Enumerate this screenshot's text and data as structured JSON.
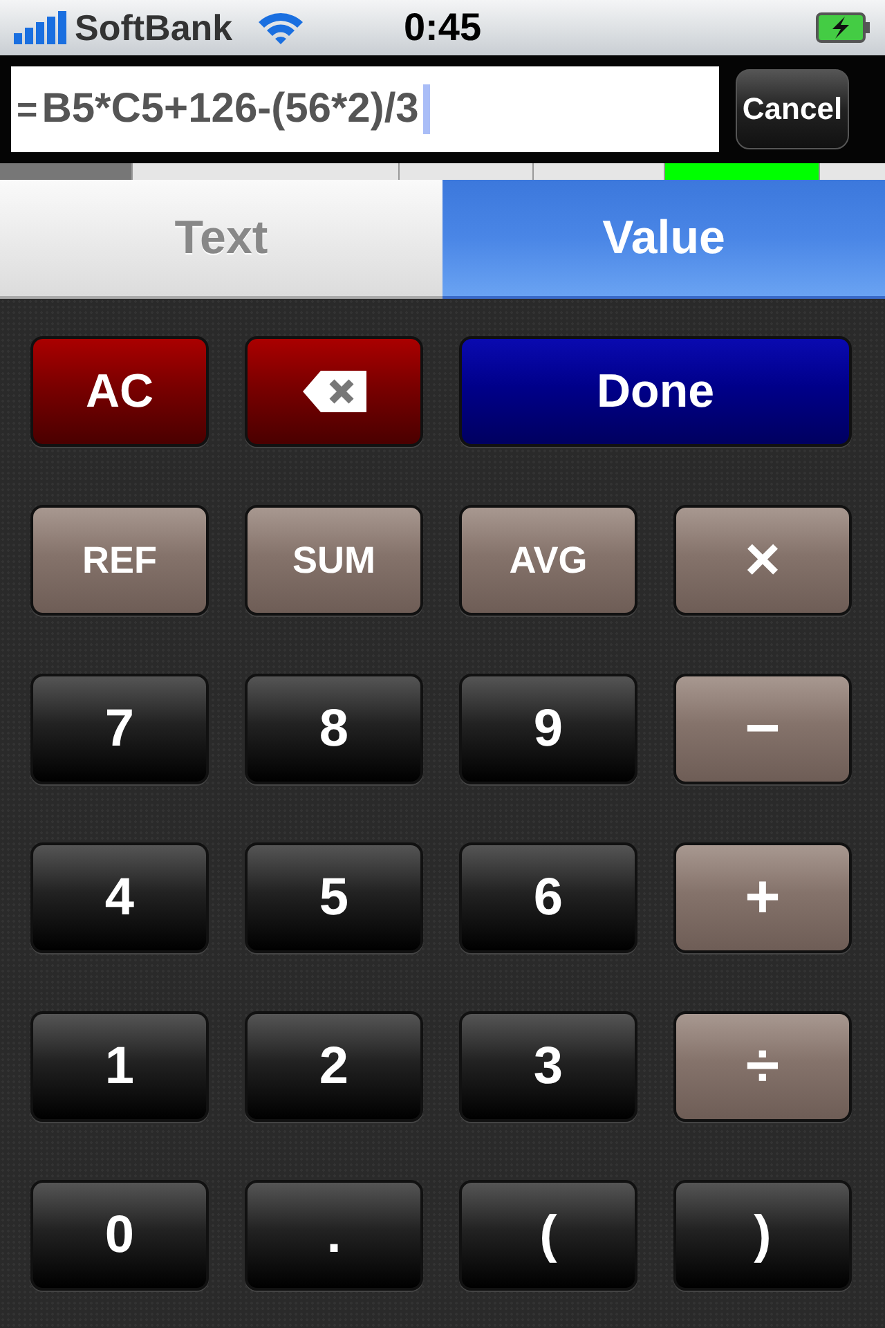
{
  "status_bar": {
    "carrier": "SoftBank",
    "time": "0:45"
  },
  "formula_bar": {
    "prefix": "=",
    "value": "B5*C5+126-(56*2)/3",
    "cancel": "Cancel"
  },
  "sheet_strip": [
    {
      "kind": "header",
      "selected": false
    },
    {
      "kind": "cell",
      "selected": false
    },
    {
      "kind": "cell",
      "selected": false
    },
    {
      "kind": "cell",
      "selected": false
    },
    {
      "kind": "cell",
      "selected": true
    },
    {
      "kind": "cell",
      "selected": false
    }
  ],
  "tabs": [
    {
      "label": "Text",
      "selected": false
    },
    {
      "label": "Value",
      "selected": true
    }
  ],
  "keys": [
    {
      "label": "AC",
      "kind": "red",
      "wide": false
    },
    {
      "kind": "delete",
      "wide": false
    },
    {
      "label": "Done",
      "kind": "blue",
      "wide": true
    },
    {
      "label": "REF",
      "kind": "brown",
      "wide": false
    },
    {
      "label": "SUM",
      "kind": "brown",
      "wide": false
    },
    {
      "label": "AVG",
      "kind": "brown",
      "wide": false
    },
    {
      "label": "×",
      "kind": "operator",
      "wide": false
    },
    {
      "label": "7",
      "kind": "black",
      "wide": false
    },
    {
      "label": "8",
      "kind": "black",
      "wide": false
    },
    {
      "label": "9",
      "kind": "black",
      "wide": false
    },
    {
      "label": "−",
      "kind": "operator",
      "wide": false
    },
    {
      "label": "4",
      "kind": "black",
      "wide": false
    },
    {
      "label": "5",
      "kind": "black",
      "wide": false
    },
    {
      "label": "6",
      "kind": "black",
      "wide": false
    },
    {
      "label": "+",
      "kind": "operator",
      "wide": false
    },
    {
      "label": "1",
      "kind": "black",
      "wide": false
    },
    {
      "label": "2",
      "kind": "black",
      "wide": false
    },
    {
      "label": "3",
      "kind": "black",
      "wide": false
    },
    {
      "label": "÷",
      "kind": "operator",
      "wide": false
    },
    {
      "label": "0",
      "kind": "black",
      "wide": false
    },
    {
      "label": ".",
      "kind": "black",
      "wide": false
    },
    {
      "label": "(",
      "kind": "black",
      "wide": false
    },
    {
      "label": ")",
      "kind": "black",
      "wide": false
    }
  ]
}
